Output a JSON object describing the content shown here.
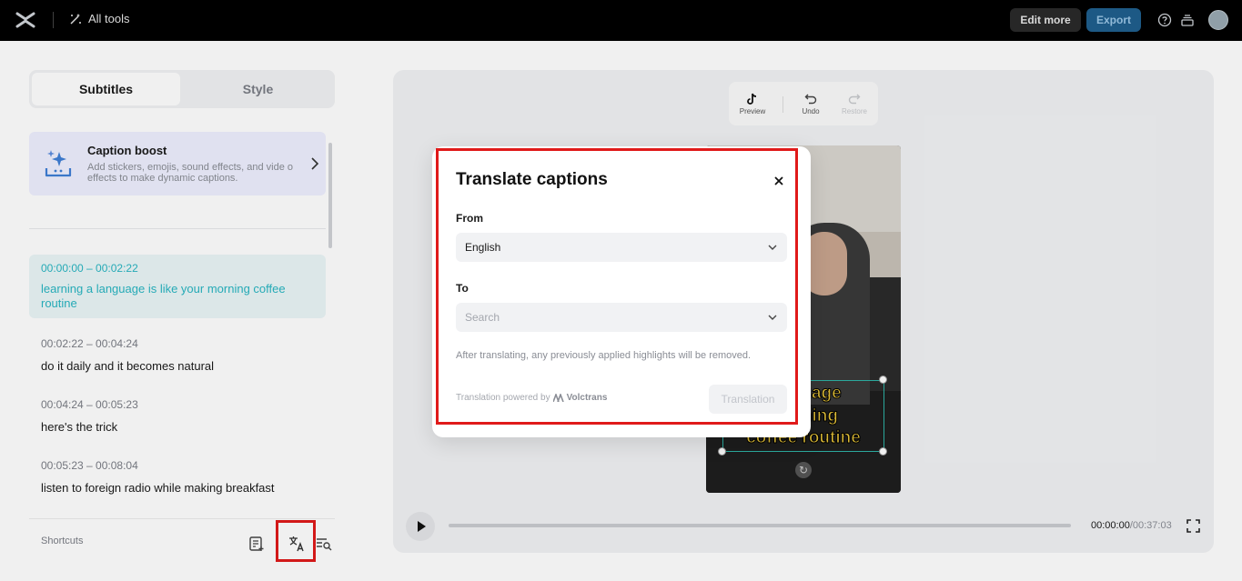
{
  "topbar": {
    "all_tools_label": "All tools",
    "edit_more_label": "Edit more",
    "export_label": "Export",
    "icons": [
      "logo-icon",
      "magic-wand-icon",
      "help-icon",
      "layers-icon",
      "avatar"
    ]
  },
  "left_panel": {
    "tabs": [
      {
        "label": "Subtitles",
        "active": true
      },
      {
        "label": "Style",
        "active": false
      }
    ],
    "caption_boost": {
      "title": "Caption boost",
      "description": "Add stickers, emojis, sound effects, and vide o effects to make dynamic captions."
    },
    "subtitles": [
      {
        "time": "00:00:00 – 00:02:22",
        "text": "learning a language is like your morning coffee routine",
        "active": true
      },
      {
        "time": "00:02:22 – 00:04:24",
        "text": "do it daily and it becomes natural",
        "active": false
      },
      {
        "time": "00:04:24 – 00:05:23",
        "text": "here's the trick",
        "active": false
      },
      {
        "time": "00:05:23 – 00:08:04",
        "text": "listen to foreign radio while making breakfast",
        "active": false
      }
    ],
    "shortcuts_label": "Shortcuts"
  },
  "preview_toolbar": {
    "preview_label": "Preview",
    "undo_label": "Undo",
    "restore_label": "Restore"
  },
  "video": {
    "caption_lines": [
      "language",
      "morning",
      "coffee routine"
    ]
  },
  "player": {
    "current_time": "00:00:00",
    "duration": "/00:37:03"
  },
  "modal": {
    "title": "Translate captions",
    "from_label": "From",
    "from_value": "English",
    "to_label": "To",
    "to_placeholder": "Search",
    "note": "After translating, any previously applied highlights will be removed.",
    "powered_by": "Translation powered by",
    "powered_brand": "Volctrans",
    "translate_button": "Translation"
  },
  "colors": {
    "accent_teal": "#28b5c2",
    "highlight_red": "#e01a1a",
    "caption_yellow": "#e8c53a",
    "export_blue": "#1f5f8e"
  }
}
